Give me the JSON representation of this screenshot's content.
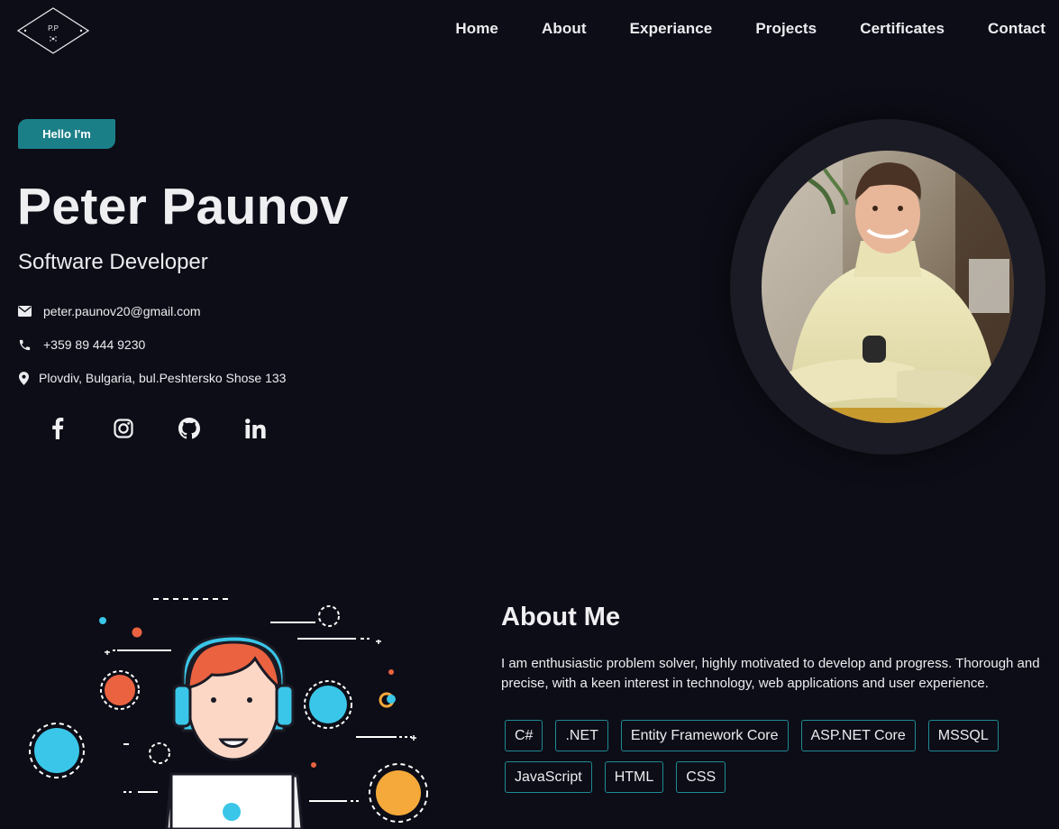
{
  "logo": {
    "text": "P.P"
  },
  "nav": [
    "Home",
    "About",
    "Experiance",
    "Projects",
    "Certificates",
    "Contact"
  ],
  "hero": {
    "badge": "Hello I'm",
    "name": "Peter Paunov",
    "role": "Software Developer",
    "email": "peter.paunov20@gmail.com",
    "phone": "+359 89 444 9230",
    "address": "Plovdiv, Bulgaria, bul.Peshtersko Shose 133",
    "socials": [
      "facebook-icon",
      "instagram-icon",
      "github-icon",
      "linkedin-icon"
    ]
  },
  "about": {
    "title": "About Me",
    "text": "I am enthusiastic problem solver, highly motivated to develop and progress. Thorough and precise, with a keen interest in technology, web applications and user experience.",
    "skills": [
      "C#",
      ".NET",
      "Entity Framework Core",
      "ASP.NET Core",
      "MSSQL",
      "JavaScript",
      "HTML",
      "CSS"
    ]
  },
  "colors": {
    "background": "#0d0d17",
    "accent": "#1b7f88",
    "text": "#ececf0"
  }
}
